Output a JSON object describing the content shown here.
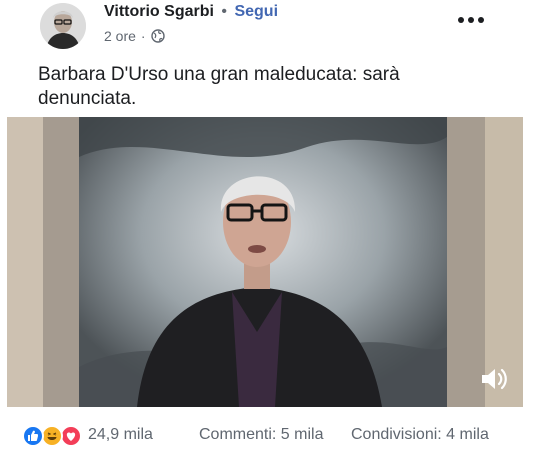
{
  "post": {
    "author": "Vittorio Sgarbi",
    "separator": "•",
    "follow_label": "Segui",
    "time": "2 ore",
    "time_separator": "·",
    "privacy_icon": "globe-icon",
    "more_icon": "more-options-icon",
    "text": "Barbara D'Urso una gran maleducata: sarà denunciata."
  },
  "video": {
    "sound_icon": "volume-icon"
  },
  "footer": {
    "reactions": [
      "like-icon",
      "haha-icon",
      "love-icon"
    ],
    "reaction_count": "24,9 mila",
    "comments": "Commenti: 5 mila",
    "shares": "Condivisioni: 4 mila"
  },
  "colors": {
    "link": "#4267b2",
    "like": "#1877f2",
    "haha": "#f7b125",
    "love": "#f33e58",
    "text_secondary": "#606770"
  }
}
